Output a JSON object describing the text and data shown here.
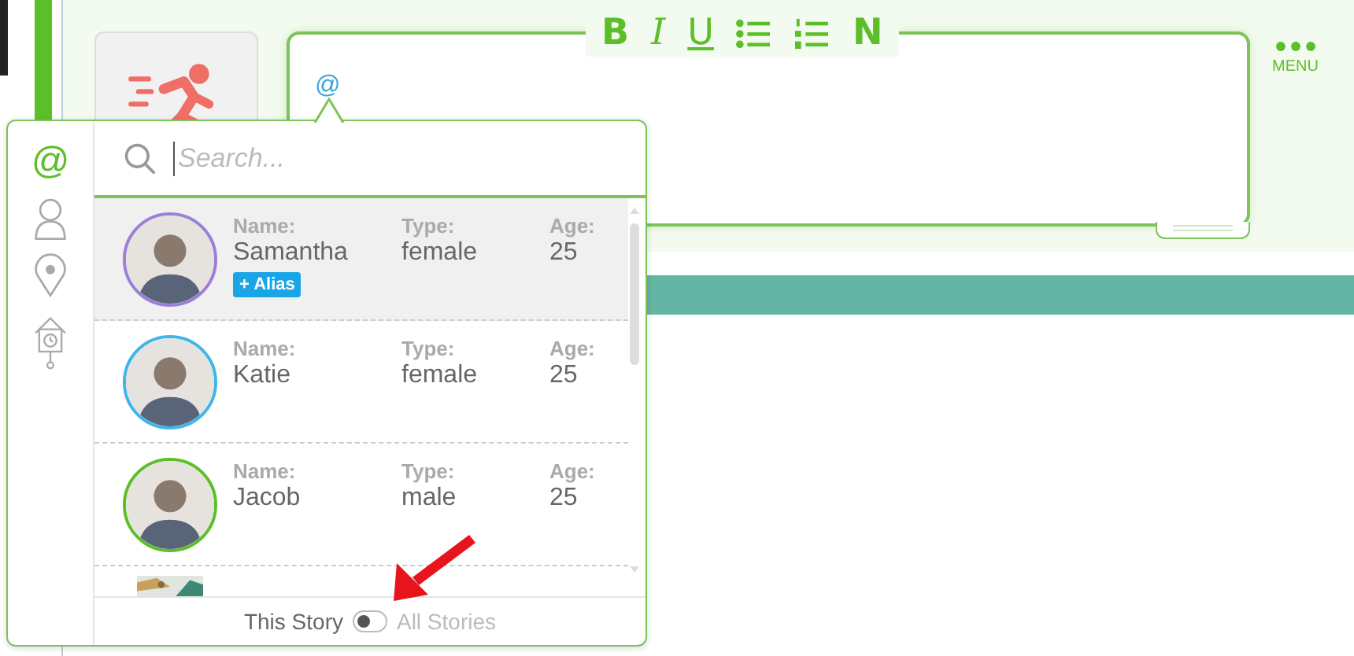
{
  "toolbar": [
    {
      "kind": "bold",
      "label": "B"
    },
    {
      "kind": "italic",
      "label": "I"
    },
    {
      "kind": "underline",
      "label": "U"
    },
    {
      "kind": "bullets"
    },
    {
      "kind": "numbers"
    },
    {
      "kind": "normal",
      "label": "N"
    }
  ],
  "editor": {
    "text": "@"
  },
  "menu": {
    "label": "MENU"
  },
  "popup": {
    "tabs": [
      {
        "kind": "mention",
        "label": "@",
        "selected": true
      },
      {
        "kind": "person",
        "selected": false
      },
      {
        "kind": "place",
        "selected": false
      },
      {
        "kind": "time",
        "selected": false
      }
    ],
    "search": {
      "placeholder": "Search..."
    },
    "rows": [
      {
        "name_label": "Name:",
        "name": "Samantha",
        "type_label": "Type:",
        "type": "female",
        "age_label": "Age:",
        "age": "25",
        "color": "#9b7fd8",
        "selected": true,
        "alias": "+ Alias"
      },
      {
        "name_label": "Name:",
        "name": "Katie",
        "type_label": "Type:",
        "type": "female",
        "age_label": "Age:",
        "age": "25",
        "color": "#3fb6e8",
        "selected": false
      },
      {
        "name_label": "Name:",
        "name": "Jacob",
        "type_label": "Type:",
        "type": "male",
        "age_label": "Age:",
        "age": "25",
        "color": "#5cbf2a",
        "selected": false
      }
    ],
    "footer": {
      "options": [
        {
          "label": "This Story",
          "selected": true
        },
        {
          "label": "All Stories",
          "selected": false
        }
      ]
    }
  }
}
